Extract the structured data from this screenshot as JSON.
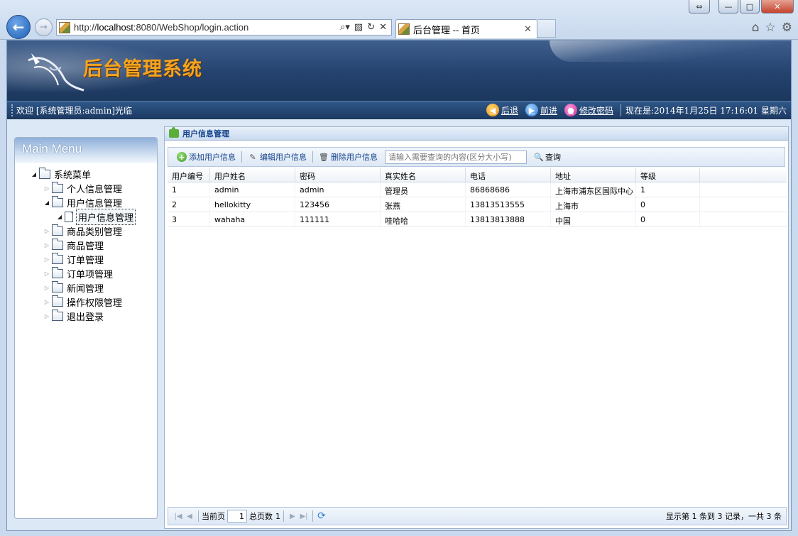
{
  "browser": {
    "url_prefix": "http://",
    "url_host": "localhost",
    "url_rest": ":8080/WebShop/login.action",
    "tab_title": "后台管理 -- 首页",
    "window_buttons": [
      "⇔",
      "—",
      "□",
      "✕"
    ]
  },
  "header": {
    "title": "后台管理系统"
  },
  "welcome_bar": {
    "welcome": "欢迎 [系统管理员:admin]光临",
    "back": "后退",
    "forward": "前进",
    "change_password": "修改密码",
    "clock": "现在是:2014年1月25日  17:16:01 星期六"
  },
  "sidebar": {
    "title": "Main Menu",
    "root": "系统菜单",
    "items": [
      {
        "label": "个人信息管理",
        "expanded": false
      },
      {
        "label": "用户信息管理",
        "expanded": true,
        "children": [
          {
            "label": "用户信息管理",
            "selected": true
          }
        ]
      },
      {
        "label": "商品类别管理",
        "expanded": false
      },
      {
        "label": "商品管理",
        "expanded": false
      },
      {
        "label": "订单管理",
        "expanded": false
      },
      {
        "label": "订单项管理",
        "expanded": false
      },
      {
        "label": "新闻管理",
        "expanded": false
      },
      {
        "label": "操作权限管理",
        "expanded": false
      },
      {
        "label": "退出登录",
        "expanded": false
      }
    ]
  },
  "panel": {
    "title": "用户信息管理",
    "toolbar": {
      "add": "添加用户信息",
      "edit": "编辑用户信息",
      "delete": "删除用户信息",
      "search_placeholder": "请输入需要查询的内容(区分大小写)",
      "search": "查询"
    },
    "columns": [
      "用户编号",
      "用户姓名",
      "密码",
      "真实姓名",
      "电话",
      "地址",
      "等级"
    ],
    "rows": [
      [
        "1",
        "admin",
        "admin",
        "管理员",
        "86868686",
        "上海市浦东区国际中心",
        "1"
      ],
      [
        "2",
        "hellokitty",
        "123456",
        "张燕",
        "13813513555",
        "上海市",
        "0"
      ],
      [
        "3",
        "wahaha",
        "111111",
        "哇哈哈",
        "13813813888",
        "中国",
        "0"
      ]
    ],
    "pager": {
      "current_label": "当前页",
      "current_page": "1",
      "total_label": "总页数",
      "total_pages": "1",
      "info": "显示第 1 条到 3 记录，一共 3 条"
    }
  }
}
